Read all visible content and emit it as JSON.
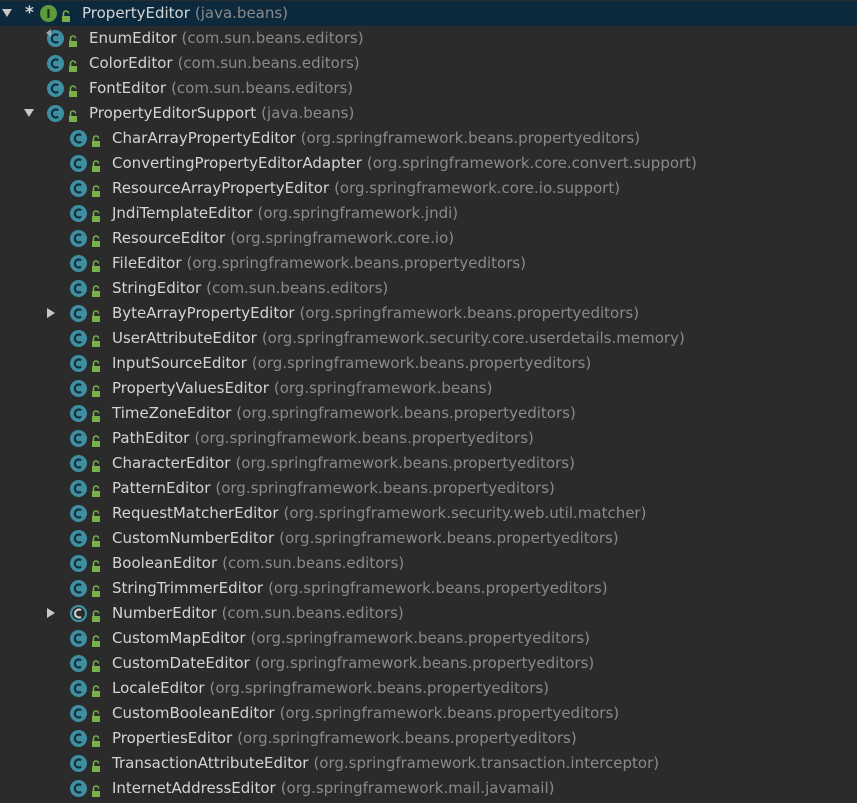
{
  "colors": {
    "background": "#2b2b2b",
    "selection": "#0d293e",
    "class_name": "#d4d4d4",
    "package_name": "#8a8a8a",
    "class_icon": "#3f8fa3",
    "interface_icon": "#5d9b3c",
    "lock": "#79b04a"
  },
  "tree": [
    {
      "name": "PropertyEditor",
      "package": "(java.beans)",
      "kind": "interface",
      "depth": 0,
      "arrow": "expanded",
      "starred": true,
      "selected": true
    },
    {
      "name": "EnumEditor",
      "package": "(com.sun.beans.editors)",
      "kind": "class",
      "depth": 1,
      "arrow": "none",
      "inherit": true
    },
    {
      "name": "ColorEditor",
      "package": "(com.sun.beans.editors)",
      "kind": "class",
      "depth": 1,
      "arrow": "none"
    },
    {
      "name": "FontEditor",
      "package": "(com.sun.beans.editors)",
      "kind": "class",
      "depth": 1,
      "arrow": "none"
    },
    {
      "name": "PropertyEditorSupport",
      "package": "(java.beans)",
      "kind": "class",
      "depth": 1,
      "arrow": "expanded"
    },
    {
      "name": "CharArrayPropertyEditor",
      "package": "(org.springframework.beans.propertyeditors)",
      "kind": "class",
      "depth": 2,
      "arrow": "none"
    },
    {
      "name": "ConvertingPropertyEditorAdapter",
      "package": "(org.springframework.core.convert.support)",
      "kind": "class",
      "depth": 2,
      "arrow": "none"
    },
    {
      "name": "ResourceArrayPropertyEditor",
      "package": "(org.springframework.core.io.support)",
      "kind": "class",
      "depth": 2,
      "arrow": "none"
    },
    {
      "name": "JndiTemplateEditor",
      "package": "(org.springframework.jndi)",
      "kind": "class",
      "depth": 2,
      "arrow": "none"
    },
    {
      "name": "ResourceEditor",
      "package": "(org.springframework.core.io)",
      "kind": "class",
      "depth": 2,
      "arrow": "none"
    },
    {
      "name": "FileEditor",
      "package": "(org.springframework.beans.propertyeditors)",
      "kind": "class",
      "depth": 2,
      "arrow": "none"
    },
    {
      "name": "StringEditor",
      "package": "(com.sun.beans.editors)",
      "kind": "class",
      "depth": 2,
      "arrow": "none"
    },
    {
      "name": "ByteArrayPropertyEditor",
      "package": "(org.springframework.beans.propertyeditors)",
      "kind": "class",
      "depth": 2,
      "arrow": "collapsed"
    },
    {
      "name": "UserAttributeEditor",
      "package": "(org.springframework.security.core.userdetails.memory)",
      "kind": "class",
      "depth": 2,
      "arrow": "none"
    },
    {
      "name": "InputSourceEditor",
      "package": "(org.springframework.beans.propertyeditors)",
      "kind": "class",
      "depth": 2,
      "arrow": "none"
    },
    {
      "name": "PropertyValuesEditor",
      "package": "(org.springframework.beans)",
      "kind": "class",
      "depth": 2,
      "arrow": "none"
    },
    {
      "name": "TimeZoneEditor",
      "package": "(org.springframework.beans.propertyeditors)",
      "kind": "class",
      "depth": 2,
      "arrow": "none"
    },
    {
      "name": "PathEditor",
      "package": "(org.springframework.beans.propertyeditors)",
      "kind": "class",
      "depth": 2,
      "arrow": "none"
    },
    {
      "name": "CharacterEditor",
      "package": "(org.springframework.beans.propertyeditors)",
      "kind": "class",
      "depth": 2,
      "arrow": "none"
    },
    {
      "name": "PatternEditor",
      "package": "(org.springframework.beans.propertyeditors)",
      "kind": "class",
      "depth": 2,
      "arrow": "none"
    },
    {
      "name": "RequestMatcherEditor",
      "package": "(org.springframework.security.web.util.matcher)",
      "kind": "class",
      "depth": 2,
      "arrow": "none"
    },
    {
      "name": "CustomNumberEditor",
      "package": "(org.springframework.beans.propertyeditors)",
      "kind": "class",
      "depth": 2,
      "arrow": "none"
    },
    {
      "name": "BooleanEditor",
      "package": "(com.sun.beans.editors)",
      "kind": "class",
      "depth": 2,
      "arrow": "none"
    },
    {
      "name": "StringTrimmerEditor",
      "package": "(org.springframework.beans.propertyeditors)",
      "kind": "class",
      "depth": 2,
      "arrow": "none"
    },
    {
      "name": "NumberEditor",
      "package": "(com.sun.beans.editors)",
      "kind": "abstract",
      "depth": 2,
      "arrow": "collapsed"
    },
    {
      "name": "CustomMapEditor",
      "package": "(org.springframework.beans.propertyeditors)",
      "kind": "class",
      "depth": 2,
      "arrow": "none"
    },
    {
      "name": "CustomDateEditor",
      "package": "(org.springframework.beans.propertyeditors)",
      "kind": "class",
      "depth": 2,
      "arrow": "none"
    },
    {
      "name": "LocaleEditor",
      "package": "(org.springframework.beans.propertyeditors)",
      "kind": "class",
      "depth": 2,
      "arrow": "none"
    },
    {
      "name": "CustomBooleanEditor",
      "package": "(org.springframework.beans.propertyeditors)",
      "kind": "class",
      "depth": 2,
      "arrow": "none"
    },
    {
      "name": "PropertiesEditor",
      "package": "(org.springframework.beans.propertyeditors)",
      "kind": "class",
      "depth": 2,
      "arrow": "none"
    },
    {
      "name": "TransactionAttributeEditor",
      "package": "(org.springframework.transaction.interceptor)",
      "kind": "class",
      "depth": 2,
      "arrow": "none"
    },
    {
      "name": "InternetAddressEditor",
      "package": "(org.springframework.mail.javamail)",
      "kind": "class",
      "depth": 2,
      "arrow": "none"
    }
  ]
}
